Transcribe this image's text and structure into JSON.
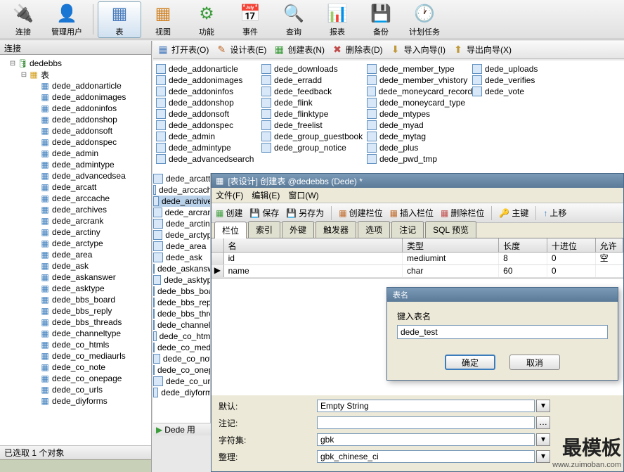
{
  "toolbar": {
    "connect": "连接",
    "users": "管理用户",
    "table": "表",
    "view": "视图",
    "function": "功能",
    "event": "事件",
    "query": "查询",
    "report": "报表",
    "backup": "备份",
    "schedule": "计划任务"
  },
  "subtoolbar": {
    "open": "打开表(O)",
    "design": "设计表(E)",
    "create": "创建表(N)",
    "delete": "删除表(D)",
    "import": "导入向导(I)",
    "export": "导出向导(X)"
  },
  "left": {
    "header": "连接",
    "db_name": "dedebbs",
    "folder": "表",
    "status": "已选取 1 个对象",
    "tree_tables": [
      "dede_addonarticle",
      "dede_addonimages",
      "dede_addoninfos",
      "dede_addonshop",
      "dede_addonsoft",
      "dede_addonspec",
      "dede_admin",
      "dede_admintype",
      "dede_advancedsea",
      "dede_arcatt",
      "dede_arccache",
      "dede_archives",
      "dede_arcrank",
      "dede_arctiny",
      "dede_arctype",
      "dede_area",
      "dede_ask",
      "dede_askanswer",
      "dede_asktype",
      "dede_bbs_board",
      "dede_bbs_reply",
      "dede_bbs_threads",
      "dede_channeltype",
      "dede_co_htmls",
      "dede_co_mediaurls",
      "dede_co_note",
      "dede_co_onepage",
      "dede_co_urls",
      "dede_diyforms"
    ]
  },
  "center": {
    "col1": [
      "dede_addonarticle",
      "dede_addonimages",
      "dede_addoninfos",
      "dede_addonshop",
      "dede_addonsoft",
      "dede_addonspec",
      "dede_admin",
      "dede_admintype",
      "dede_advancedsearch",
      "dede_arcatt",
      "dede_arccache",
      "dede_archives",
      "dede_arcrank",
      "dede_arctiny",
      "dede_arctype",
      "dede_area",
      "dede_ask",
      "dede_askanswer",
      "dede_asktype",
      "dede_bbs_board",
      "dede_bbs_reply",
      "dede_bbs_threa",
      "dede_channelty",
      "dede_co_htmls",
      "dede_co_mediau",
      "dede_co_note",
      "dede_co_onepa",
      "dede_co_urls",
      "dede_diyforms"
    ],
    "col2": [
      "dede_downloads",
      "dede_erradd",
      "dede_feedback",
      "dede_flink",
      "dede_flinktype",
      "dede_freelist",
      "dede_group_guestbook",
      "dede_group_notice"
    ],
    "col3": [
      "dede_member_type",
      "dede_member_vhistory",
      "dede_moneycard_record",
      "dede_moneycard_type",
      "dede_mtypes",
      "dede_myad",
      "dede_mytag",
      "dede_plus",
      "dede_pwd_tmp"
    ],
    "col4": [
      "dede_uploads",
      "dede_verifies",
      "dede_vote"
    ],
    "selected": "dede_archives",
    "status_label": "Dede",
    "status_suffix": "用"
  },
  "design": {
    "title": "[表设计] 创建表 @dedebbs (Dede) *",
    "menu_file": "文件(F)",
    "menu_edit": "编辑(E)",
    "menu_window": "窗口(W)",
    "tools": {
      "create": "创建",
      "save": "保存",
      "saveas": "另存为",
      "addfield": "创建栏位",
      "insertfield": "插入栏位",
      "deletefield": "删除栏位",
      "primary": "主键",
      "moveup": "上移"
    },
    "tabs": {
      "fields": "栏位",
      "index": "索引",
      "fk": "外键",
      "trigger": "触发器",
      "options": "选项",
      "comment": "注记",
      "preview": "SQL 预览"
    },
    "grid_headers": {
      "name": "名",
      "type": "类型",
      "length": "长度",
      "decimal": "十进位",
      "null": "允许空"
    },
    "grid_rows": [
      {
        "name": "id",
        "type": "mediumint",
        "length": "8",
        "decimal": "0"
      },
      {
        "name": "name",
        "type": "char",
        "length": "60",
        "decimal": "0"
      }
    ],
    "props": {
      "default_label": "默认:",
      "default_value": "Empty String",
      "comment_label": "注记:",
      "comment_value": "",
      "charset_label": "字符集:",
      "charset_value": "gbk",
      "collation_label": "整理:",
      "collation_value": "gbk_chinese_ci"
    }
  },
  "dialog": {
    "title": "表名",
    "label": "键入表名",
    "value": "dede_test",
    "ok": "确定",
    "cancel": "取消"
  },
  "watermark": {
    "main": "最模板",
    "url": "www.zuimoban.com"
  }
}
